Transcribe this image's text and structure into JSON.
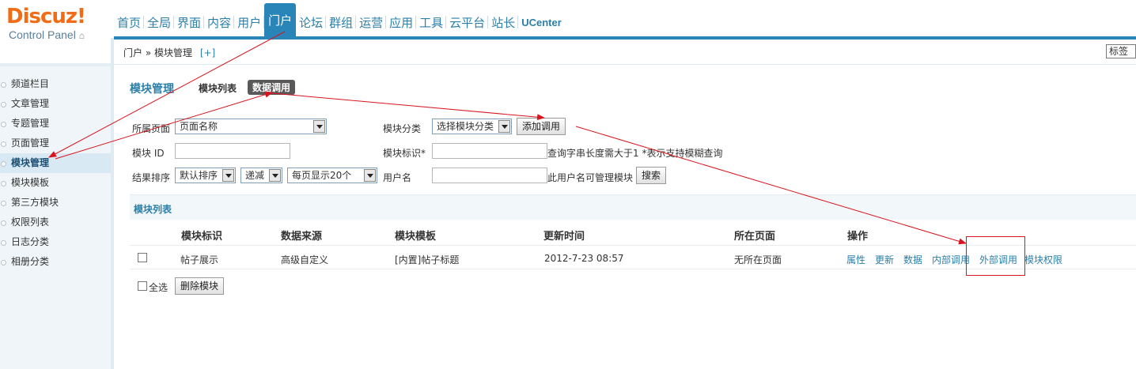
{
  "logo": {
    "brand": "Discuz!",
    "sub": "Control Panel",
    "home_icon": "home-icon"
  },
  "topnav": {
    "items": [
      "首页",
      "全局",
      "界面",
      "内容",
      "用户",
      "门户",
      "论坛",
      "群组",
      "运营",
      "应用",
      "工具",
      "云平台",
      "站长",
      "UCenter"
    ],
    "active": "门户"
  },
  "breadcrumb": {
    "path": "门户 » 模块管理",
    "plus": "[+]"
  },
  "quick_select": "标签",
  "sidebar": {
    "items": [
      "频道栏目",
      "文章管理",
      "专题管理",
      "页面管理",
      "模块管理",
      "模块模板",
      "第三方模块",
      "权限列表",
      "日志分类",
      "相册分类"
    ],
    "active": "模块管理"
  },
  "main": {
    "title": "模块管理",
    "tabs": [
      "模块列表",
      "数据调用"
    ],
    "current_tab": "数据调用"
  },
  "filters": {
    "page_label": "所属页面",
    "page_select": "页面名称",
    "category_label": "模块分类",
    "category_select": "选择模块分类",
    "add_button": "添加调用",
    "id_label": "模块 ID",
    "id_value": "",
    "ident_label": "模块标识*",
    "ident_value": "",
    "ident_hint": "查询字串长度需大于1 *表示支持模糊查询",
    "sort_label": "结果排序",
    "sort_select": "默认排序",
    "order_select": "递减",
    "perpage_select": "每页显示20个",
    "user_label": "用户名",
    "user_value": "",
    "user_hint": "此用户名可管理模块",
    "search_button": "搜索"
  },
  "list": {
    "title": "模块列表",
    "headers": [
      "模块标识",
      "数据来源",
      "模块模板",
      "更新时间",
      "所在页面",
      "操作"
    ],
    "rows": [
      {
        "checked": false,
        "ident": "帖子展示",
        "source": "高级自定义",
        "template": "[内置]帖子标题",
        "updated": "2012-7-23 08:57",
        "page": "无所在页面",
        "ops": [
          "属性",
          "更新",
          "数据",
          "内部调用",
          "外部调用",
          "模块权限"
        ]
      }
    ],
    "select_all": "全选",
    "delete_button": "删除模块"
  },
  "annotation": {
    "color": "#d9141d",
    "highlighted_op": "外部调用"
  }
}
